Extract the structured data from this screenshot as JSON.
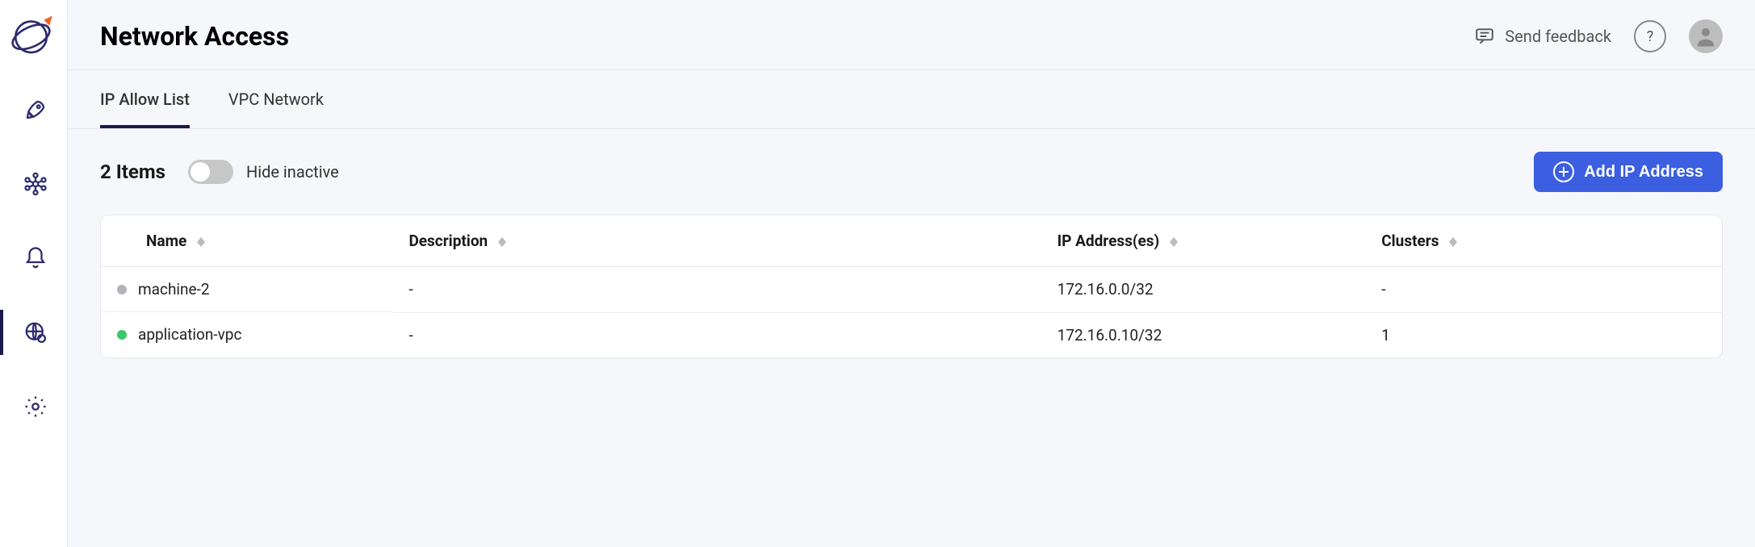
{
  "header": {
    "title": "Network Access",
    "feedback_label": "Send feedback"
  },
  "tabs": [
    {
      "label": "IP Allow List",
      "active": true
    },
    {
      "label": "VPC Network",
      "active": false
    }
  ],
  "controls": {
    "item_count_label": "2 Items",
    "hide_inactive_label": "Hide inactive",
    "hide_inactive_on": false,
    "add_button_label": "Add IP Address"
  },
  "table": {
    "columns": {
      "name": "Name",
      "description": "Description",
      "ip": "IP Address(es)",
      "clusters": "Clusters"
    },
    "rows": [
      {
        "status": "gray",
        "name": "machine-2",
        "description": "-",
        "ip": "172.16.0.0/32",
        "clusters": "-"
      },
      {
        "status": "green",
        "name": "application-vpc",
        "description": "-",
        "ip": "172.16.0.10/32",
        "clusters": "1"
      }
    ]
  }
}
